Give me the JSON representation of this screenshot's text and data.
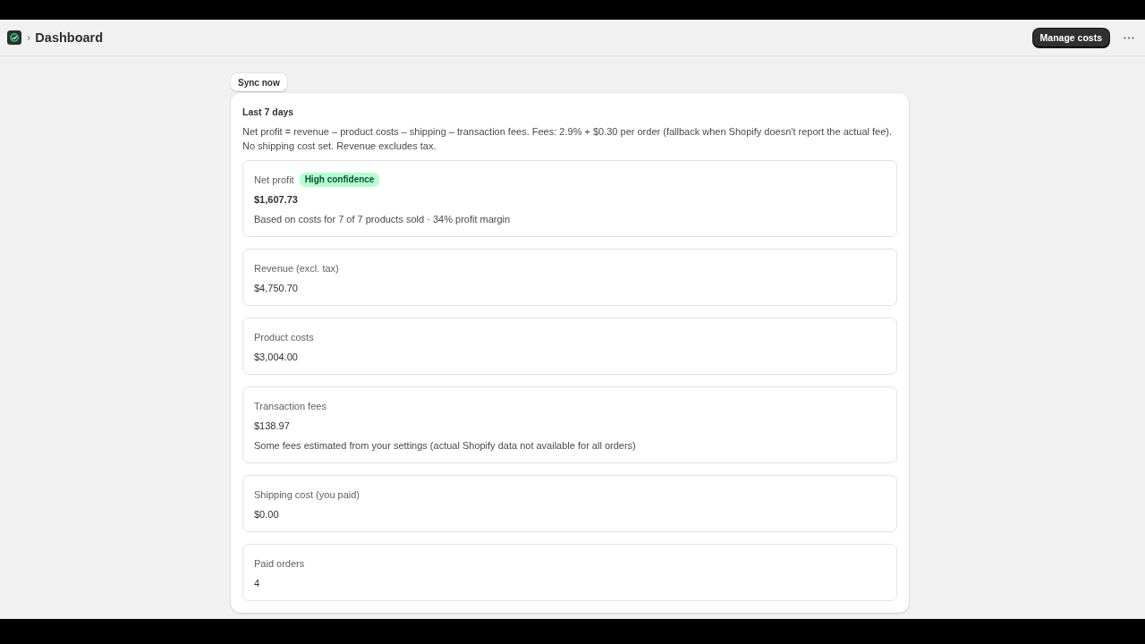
{
  "header": {
    "separator": "›",
    "title": "Dashboard",
    "primary_action": "Manage costs"
  },
  "sync_button": "Sync now",
  "summary": {
    "period": "Last 7 days",
    "description": "Net profit = revenue – product costs – shipping – transaction fees. Fees: 2.9% + $0.30 per order (fallback when Shopify doesn't report the actual fee). No shipping cost set. Revenue excludes tax."
  },
  "metrics": [
    {
      "kind": "headline",
      "label": "Net profit",
      "badge": "High confidence",
      "value": "$1,607.73",
      "note": "Based on costs for 7 of 7 products sold · 34% profit margin"
    },
    {
      "kind": "standard",
      "label": "Revenue (excl. tax)",
      "value": "$4,750.70"
    },
    {
      "kind": "standard",
      "label": "Product costs",
      "value": "$3,004.00"
    },
    {
      "kind": "standard",
      "label": "Transaction fees",
      "value": "$138.97",
      "note": "Some fees estimated from your settings (actual Shopify data not available for all orders)"
    },
    {
      "kind": "standard",
      "label": "Shipping cost (you paid)",
      "value": "$0.00"
    },
    {
      "kind": "standard",
      "label": "Paid orders",
      "value": "4"
    }
  ]
}
